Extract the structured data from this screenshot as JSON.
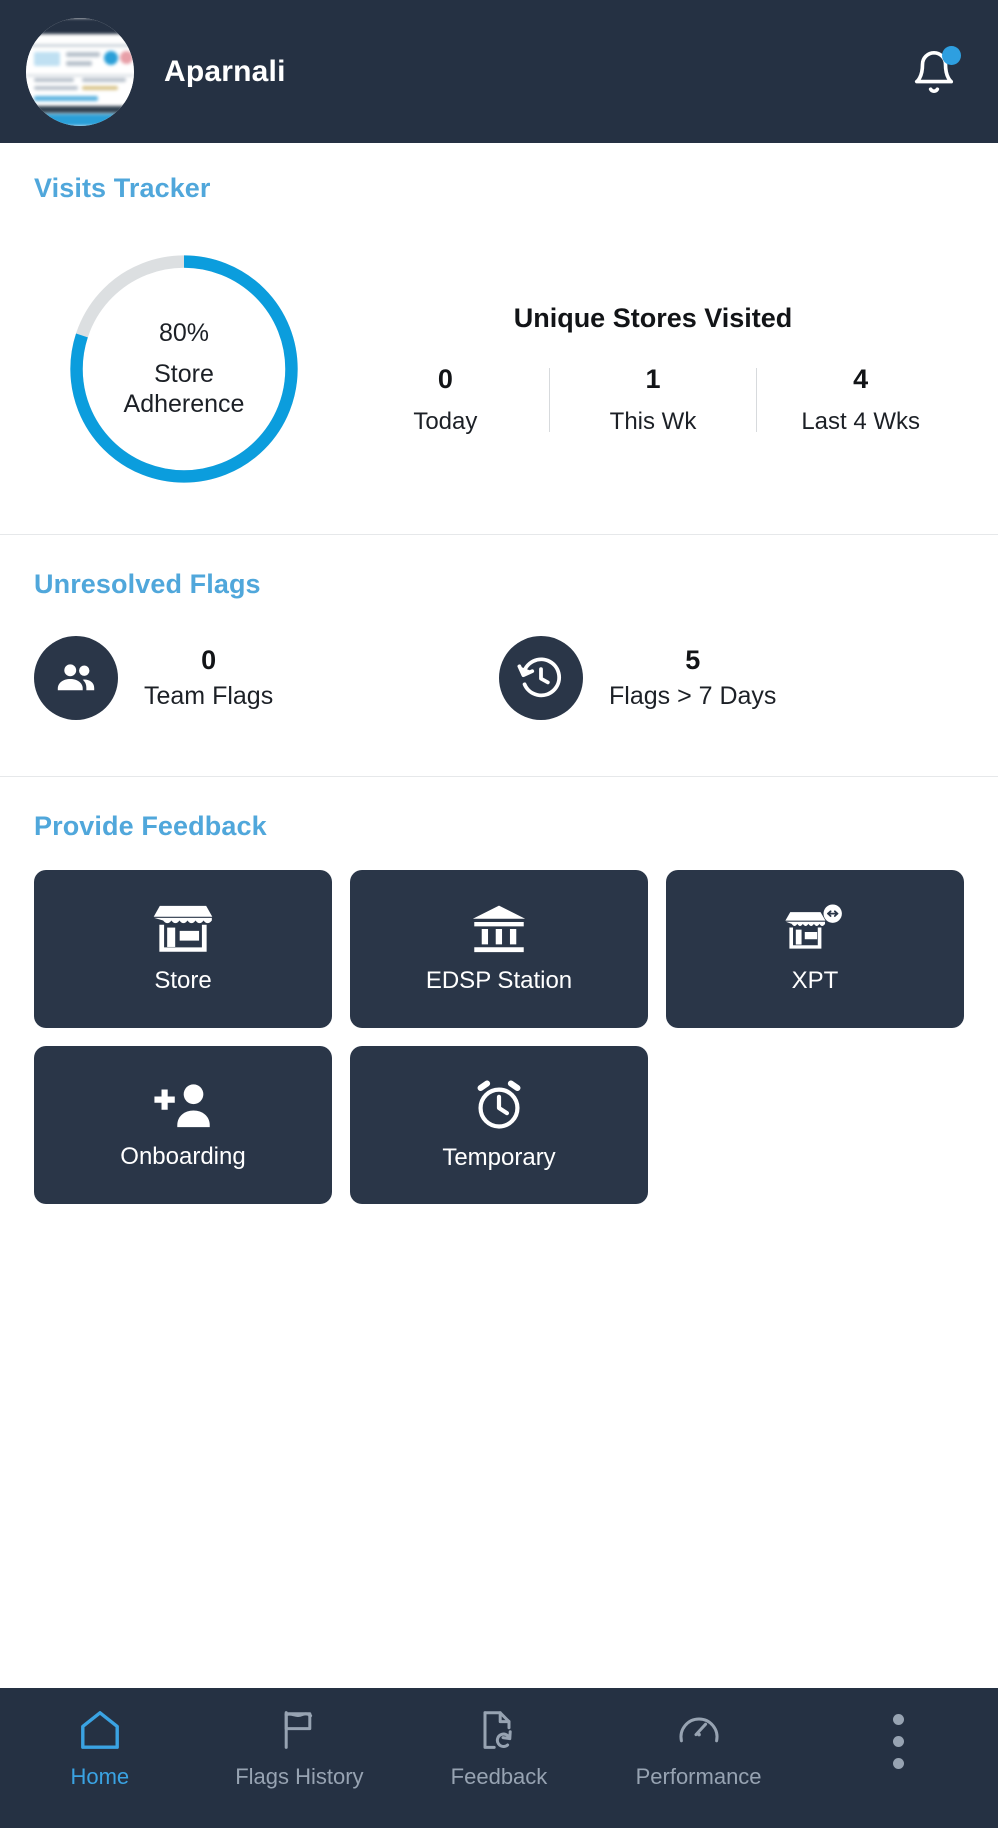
{
  "header": {
    "title": "Aparnali",
    "avatar_icon": "user-avatar-thumbnail",
    "bell_icon": "notification-bell-icon",
    "badge_present": true
  },
  "visits_tracker": {
    "title": "Visits Tracker",
    "donut": {
      "percent_label": "80%",
      "caption_line1": "Store",
      "caption_line2": "Adherence",
      "value": 80,
      "track_color": "#dcdfe1",
      "fill_color": "#0b9ddd"
    },
    "stats_heading": "Unique Stores Visited",
    "stats": [
      {
        "value": "0",
        "label": "Today"
      },
      {
        "value": "1",
        "label": "This Wk"
      },
      {
        "value": "4",
        "label": "Last 4 Wks"
      }
    ]
  },
  "unresolved_flags": {
    "title": "Unresolved Flags",
    "items": [
      {
        "icon": "people-group-icon",
        "value": "0",
        "label": "Team Flags"
      },
      {
        "icon": "history-clock-icon",
        "value": "5",
        "label": "Flags > 7 Days"
      }
    ]
  },
  "provide_feedback": {
    "title": "Provide Feedback",
    "tiles": [
      {
        "icon": "storefront-icon",
        "label": "Store"
      },
      {
        "icon": "bank-building-icon",
        "label": "EDSP Station"
      },
      {
        "icon": "store-transfer-icon",
        "label": "XPT"
      },
      {
        "icon": "person-add-icon",
        "label": "Onboarding"
      },
      {
        "icon": "alarm-clock-icon",
        "label": "Temporary"
      }
    ]
  },
  "bottom_nav": {
    "items": [
      {
        "icon": "home-icon",
        "label": "Home",
        "active": true
      },
      {
        "icon": "flag-icon",
        "label": "Flags History",
        "active": false
      },
      {
        "icon": "document-refresh-icon",
        "label": "Feedback",
        "active": false
      },
      {
        "icon": "speedometer-icon",
        "label": "Performance",
        "active": false
      },
      {
        "icon": "more-vertical-icon",
        "label": "",
        "active": false
      }
    ]
  },
  "colors": {
    "header_bg": "#253143",
    "accent_blue": "#50a7db",
    "donut_blue": "#0b9ddd",
    "tile_bg": "#2a3648"
  }
}
